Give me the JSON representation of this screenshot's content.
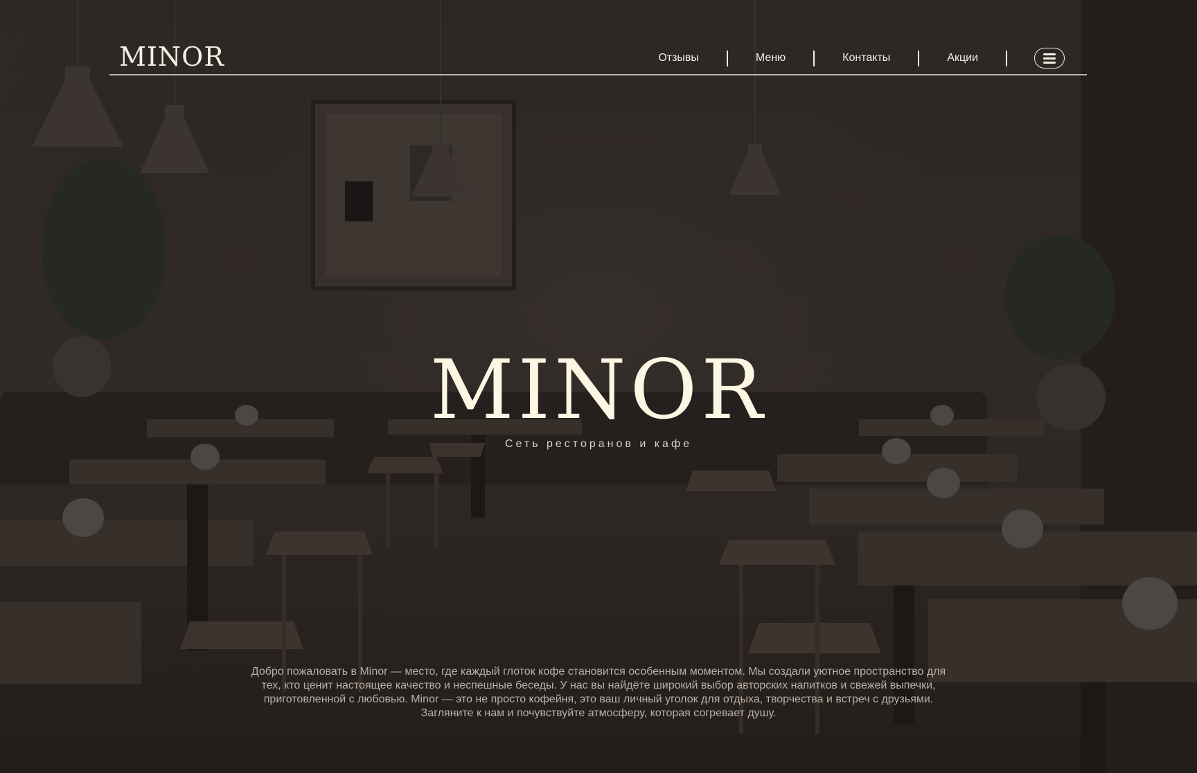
{
  "header": {
    "logo": "MINOR",
    "nav": [
      {
        "label": "Отзывы"
      },
      {
        "label": "Меню"
      },
      {
        "label": "Контакты"
      },
      {
        "label": "Акции"
      }
    ],
    "menu_icon": "hamburger-icon"
  },
  "hero": {
    "title": "MINOR",
    "subtitle": "Сеть ресторанов и кафе"
  },
  "intro": {
    "text": "Добро пожаловать в Minor — место, где каждый глоток кофе становится особенным моментом. Мы создали уютное пространство для тех, кто ценит настоящее качество и неспешные беседы. У нас вы найдёте широкий выбор авторских напитков и свежей выпечки, приготовленной с любовью. Minor — это не просто кофейня, это ваш личный уголок для отдыха, творчества и встреч с друзьями. Загляните к нам и почувствуйте атмосферу, которая согревает душу."
  },
  "colors": {
    "text_light": "#f3efe5",
    "hero_title": "#fcf6e3",
    "intro_text": "#b9b1a5",
    "background": "#2f2a28"
  }
}
